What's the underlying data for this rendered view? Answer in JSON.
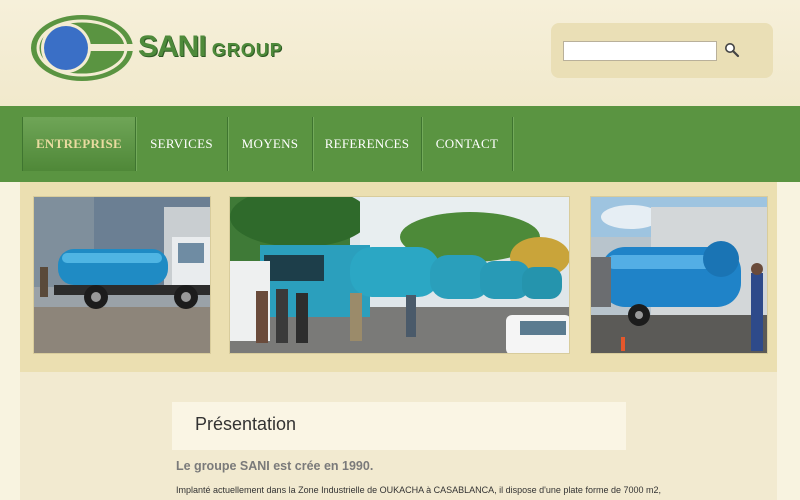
{
  "brand": {
    "name_main": "SANI",
    "name_sub": "GROUP",
    "colors": {
      "green": "#5a9441",
      "blue": "#3a6fc6",
      "cream": "#f3ecd2"
    }
  },
  "search": {
    "placeholder": "",
    "value": "",
    "icon": "search-icon"
  },
  "nav": {
    "items": [
      {
        "label": "ENTREPRISE",
        "active": true
      },
      {
        "label": "SERVICES",
        "active": false
      },
      {
        "label": "MOYENS",
        "active": false
      },
      {
        "label": "REFERENCES",
        "active": false
      },
      {
        "label": "CONTACT",
        "active": false
      }
    ]
  },
  "gallery": {
    "images": [
      {
        "name": "tanker-truck-left"
      },
      {
        "name": "fleet-with-crew"
      },
      {
        "name": "tanker-truck-right"
      }
    ]
  },
  "main": {
    "section_title": "Présentation",
    "heading": "Le groupe SANI est crée en 1990.",
    "text": "Implanté actuellement dans la Zone Industrielle de OUKACHA à CASABLANCA, il dispose d'une plate forme de 7000 m2,"
  }
}
